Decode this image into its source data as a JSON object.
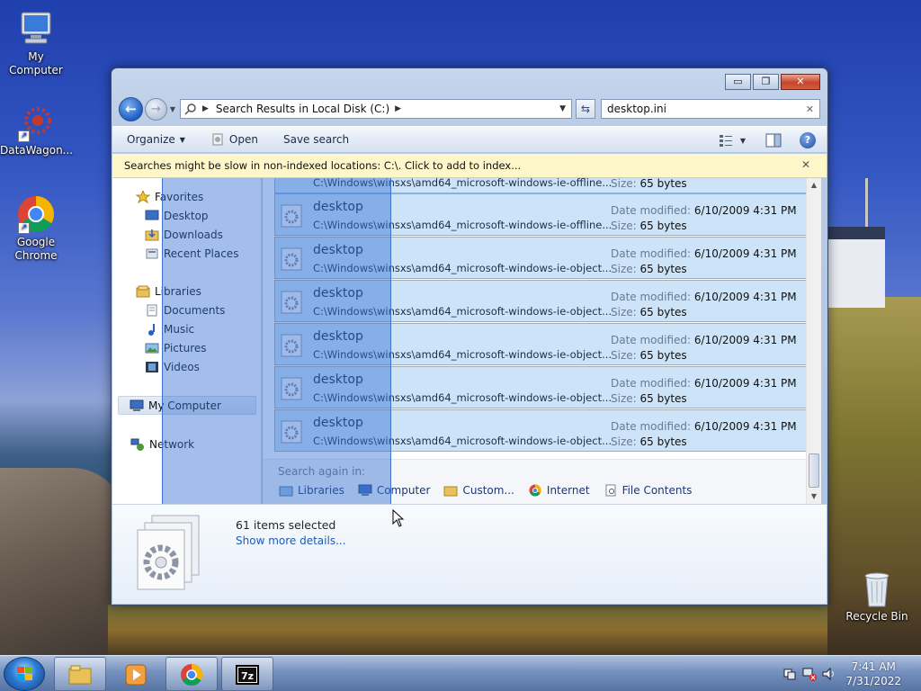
{
  "desktop": {
    "icons": [
      {
        "label": "My Computer"
      },
      {
        "label": "DataWagon..."
      },
      {
        "label": "Google Chrome"
      },
      {
        "label": "Recycle Bin"
      }
    ]
  },
  "window": {
    "controls": {
      "minimize": "▭",
      "maximize": "❐",
      "close": "✕"
    },
    "address": {
      "crumb": "Search Results in Local Disk (C:)"
    },
    "search": {
      "value": "desktop.ini"
    },
    "toolbar": {
      "organize": "Organize",
      "open": "Open",
      "save_search": "Save search"
    },
    "infobar": {
      "message": "Searches might be slow in non-indexed locations: C:\\. Click to add to index..."
    },
    "nav": {
      "favorites": "Favorites",
      "favorites_items": [
        "Desktop",
        "Downloads",
        "Recent Places"
      ],
      "libraries": "Libraries",
      "libraries_items": [
        "Documents",
        "Music",
        "Pictures",
        "Videos"
      ],
      "computer": "My Computer",
      "network": "Network"
    },
    "results": {
      "partial": {
        "path": "C:\\Windows\\winsxs\\amd64_microsoft-windows-ie-offline...",
        "size_label": "Size:",
        "size": "65 bytes"
      },
      "items": [
        {
          "name": "desktop",
          "path": "C:\\Windows\\winsxs\\amd64_microsoft-windows-ie-offline...",
          "date_label": "Date modified:",
          "date": "6/10/2009 4:31 PM",
          "size_label": "Size:",
          "size": "65 bytes"
        },
        {
          "name": "desktop",
          "path": "C:\\Windows\\winsxs\\amd64_microsoft-windows-ie-object...",
          "date_label": "Date modified:",
          "date": "6/10/2009 4:31 PM",
          "size_label": "Size:",
          "size": "65 bytes"
        },
        {
          "name": "desktop",
          "path": "C:\\Windows\\winsxs\\amd64_microsoft-windows-ie-object...",
          "date_label": "Date modified:",
          "date": "6/10/2009 4:31 PM",
          "size_label": "Size:",
          "size": "65 bytes"
        },
        {
          "name": "desktop",
          "path": "C:\\Windows\\winsxs\\amd64_microsoft-windows-ie-object...",
          "date_label": "Date modified:",
          "date": "6/10/2009 4:31 PM",
          "size_label": "Size:",
          "size": "65 bytes"
        },
        {
          "name": "desktop",
          "path": "C:\\Windows\\winsxs\\amd64_microsoft-windows-ie-object...",
          "date_label": "Date modified:",
          "date": "6/10/2009 4:31 PM",
          "size_label": "Size:",
          "size": "65 bytes"
        },
        {
          "name": "desktop",
          "path": "C:\\Windows\\winsxs\\amd64_microsoft-windows-ie-object...",
          "date_label": "Date modified:",
          "date": "6/10/2009 4:31 PM",
          "size_label": "Size:",
          "size": "65 bytes"
        }
      ]
    },
    "search_again": {
      "label": "Search again in:",
      "links": [
        "Libraries",
        "Computer",
        "Custom...",
        "Internet",
        "File Contents"
      ]
    },
    "details": {
      "count": "61 items selected",
      "more": "Show more details..."
    }
  },
  "taskbar": {
    "clock_time": "7:41 AM",
    "clock_date": "7/31/2022"
  }
}
